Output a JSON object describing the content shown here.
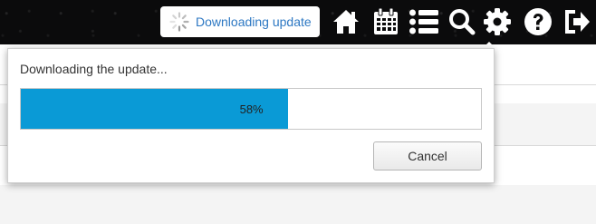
{
  "header": {
    "download_status": "Downloading update",
    "nav_icons": [
      "home-icon",
      "calendar-icon",
      "list-icon",
      "search-icon",
      "gear-icon",
      "help-icon",
      "logout-icon"
    ]
  },
  "dialog": {
    "title": "Downloading the update...",
    "progress": {
      "percent": 58,
      "label": "58%",
      "fill_color": "#0a9ad6"
    },
    "cancel_label": "Cancel"
  },
  "colors": {
    "header_bg": "#0b0b0c",
    "accent_text": "#2d78c3",
    "icon_color": "#ffffff"
  }
}
